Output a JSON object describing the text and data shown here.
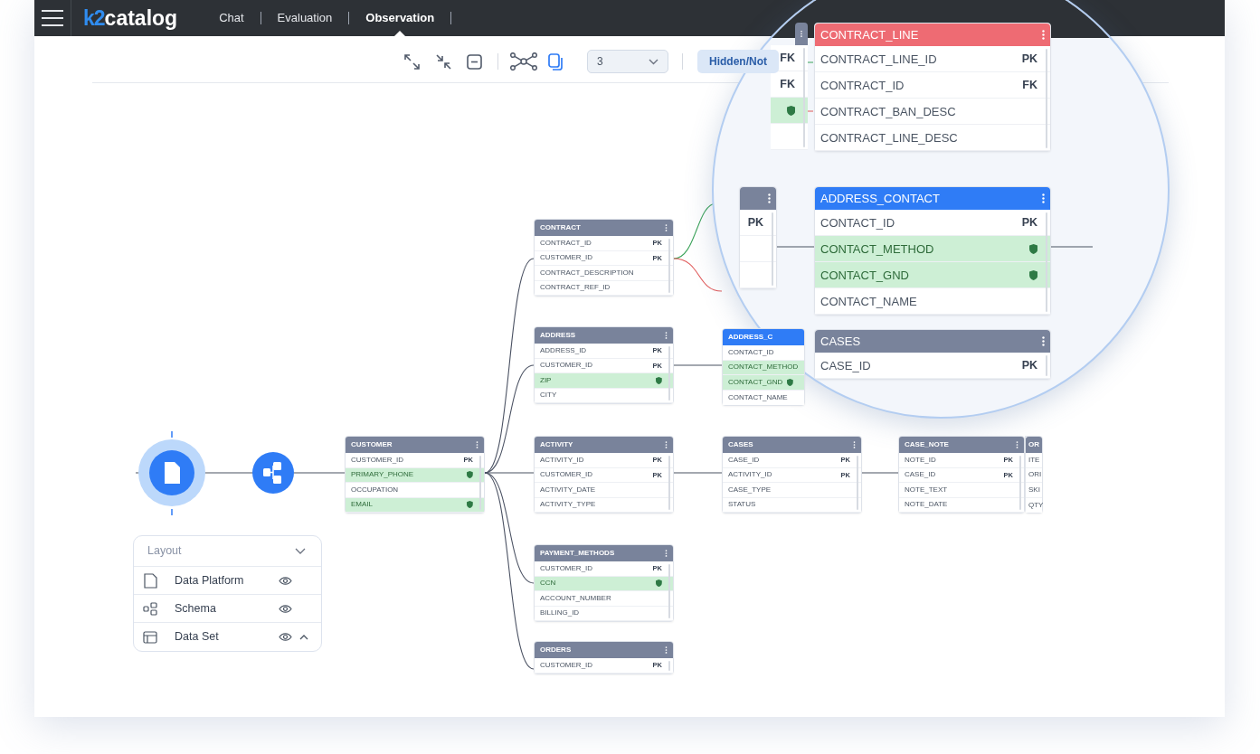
{
  "nav": {
    "logo": {
      "mark": "k2",
      "name": "catalog"
    },
    "tabs": [
      {
        "label": "Chat",
        "selected": false
      },
      {
        "label": "Evaluation",
        "selected": false
      },
      {
        "label": "Observation",
        "selected": true
      }
    ]
  },
  "toolbar": {
    "depth_select": {
      "value": "3"
    },
    "filter_button": "Hidden/Not"
  },
  "diagram": {
    "tables": [
      {
        "title": "CONTRACT",
        "color": "#79839b",
        "rows": [
          {
            "name": "CONTRACT_ID",
            "key": "PK",
            "sensitive": false
          },
          {
            "name": "CUSTOMER_ID",
            "key": "PK",
            "sensitive": false
          },
          {
            "name": "CONTRACT_DESCRIPTION",
            "sensitive": false
          },
          {
            "name": "CONTRACT_REF_ID",
            "sensitive": false
          }
        ]
      },
      {
        "title": "ADDRESS",
        "color": "#79839b",
        "rows": [
          {
            "name": "ADDRESS_ID",
            "key": "PK",
            "sensitive": false
          },
          {
            "name": "CUSTOMER_ID",
            "key": "PK",
            "sensitive": false
          },
          {
            "name": "ZIP",
            "sensitive": true
          },
          {
            "name": "CITY",
            "sensitive": false
          }
        ]
      },
      {
        "title": "ADDRESS_C",
        "color": "#2f7cf6",
        "rows": [
          {
            "name": "CONTACT_ID",
            "sensitive": false
          },
          {
            "name": "CONTACT_METHOD",
            "sensitive": true
          },
          {
            "name": "CONTACT_GND",
            "sensitive": true
          },
          {
            "name": "CONTACT_NAME",
            "sensitive": false
          }
        ]
      },
      {
        "title": "CUSTOMER",
        "color": "#79839b",
        "rows": [
          {
            "name": "CUSTOMER_ID",
            "key": "PK",
            "sensitive": false
          },
          {
            "name": "PRIMARY_PHONE",
            "sensitive": true
          },
          {
            "name": "OCCUPATION",
            "sensitive": false
          },
          {
            "name": "EMAIL",
            "sensitive": true
          }
        ]
      },
      {
        "title": "ACTIVITY",
        "color": "#79839b",
        "rows": [
          {
            "name": "ACTIVITY_ID",
            "key": "PK",
            "sensitive": false
          },
          {
            "name": "CUSTOMER_ID",
            "key": "PK",
            "sensitive": false
          },
          {
            "name": "ACTIVITY_DATE",
            "sensitive": false
          },
          {
            "name": "ACTIVITY_TYPE",
            "sensitive": false
          }
        ]
      },
      {
        "title": "CASES",
        "color": "#79839b",
        "rows": [
          {
            "name": "CASE_ID",
            "key": "PK",
            "sensitive": false
          },
          {
            "name": "ACTIVITY_ID",
            "key": "PK",
            "sensitive": false
          },
          {
            "name": "CASE_TYPE",
            "sensitive": false
          },
          {
            "name": "STATUS",
            "sensitive": false
          }
        ]
      },
      {
        "title": "CASE_NOTE",
        "color": "#79839b",
        "rows": [
          {
            "name": "NOTE_ID",
            "key": "PK",
            "sensitive": false
          },
          {
            "name": "CASE_ID",
            "key": "PK",
            "sensitive": false
          },
          {
            "name": "NOTE_TEXT",
            "sensitive": false
          },
          {
            "name": "NOTE_DATE",
            "sensitive": false
          }
        ]
      },
      {
        "title": "OR",
        "color": "#79839b",
        "rows": [
          {
            "name": "ITE",
            "sensitive": false
          },
          {
            "name": "ORI",
            "sensitive": false
          },
          {
            "name": "SKI",
            "sensitive": false
          },
          {
            "name": "QTY",
            "sensitive": false
          }
        ]
      },
      {
        "title": "PAYMENT_METHODS",
        "color": "#79839b",
        "rows": [
          {
            "name": "CUSTOMER_ID",
            "key": "PK",
            "sensitive": false
          },
          {
            "name": "CCN",
            "sensitive": true
          },
          {
            "name": "ACCOUNT_NUMBER",
            "sensitive": false
          },
          {
            "name": "BILLING_ID",
            "sensitive": false
          }
        ]
      },
      {
        "title": "ORDERS",
        "color": "#79839b",
        "rows": [
          {
            "name": "CUSTOMER_ID",
            "key": "PK",
            "sensitive": false
          }
        ]
      }
    ]
  },
  "magnifier": {
    "tables": [
      {
        "color": "#79839b",
        "rows": [
          {
            "key": "FK",
            "sensitive": false
          },
          {
            "key": "FK",
            "sensitive": false
          },
          {
            "sensitive": true
          },
          {
            "sensitive": false
          }
        ]
      },
      {
        "title": "CONTRACT_LINE",
        "color": "#ee6b73",
        "rows": [
          {
            "name": "CONTRACT_LINE_ID",
            "key": "PK",
            "sensitive": false
          },
          {
            "name": "CONTRACT_ID",
            "key": "FK",
            "sensitive": false
          },
          {
            "name": "CONTRACT_BAN_DESC",
            "sensitive": false
          },
          {
            "name": "CONTRACT_LINE_DESC",
            "sensitive": false
          }
        ]
      },
      {
        "color": "#79839b",
        "rows": [
          {
            "key": "PK",
            "sensitive": false
          },
          {
            "sensitive": false
          },
          {
            "sensitive": false
          }
        ]
      },
      {
        "title": "ADDRESS_CONTACT",
        "color": "#2f7cf6",
        "rows": [
          {
            "name": "CONTACT_ID",
            "key": "PK",
            "sensitive": false
          },
          {
            "name": "CONTACT_METHOD",
            "sensitive": true
          },
          {
            "name": "CONTACT_GND",
            "sensitive": true
          },
          {
            "name": "CONTACT_NAME",
            "sensitive": false
          }
        ]
      },
      {
        "title": "CASES",
        "color": "#79839b",
        "rows": [
          {
            "name": "CASE_ID",
            "key": "PK",
            "sensitive": false
          }
        ]
      }
    ]
  },
  "layout_panel": {
    "title": "Layout",
    "items": [
      {
        "label": "Data Platform",
        "kind": "platform",
        "visible": true,
        "expanded": false
      },
      {
        "label": "Schema",
        "kind": "schema",
        "visible": true,
        "expanded": false
      },
      {
        "label": "Data Set",
        "kind": "dataset",
        "visible": true,
        "expanded": true
      }
    ]
  }
}
